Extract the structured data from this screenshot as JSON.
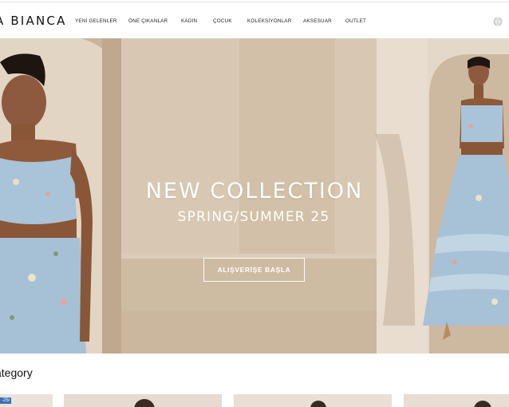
{
  "brand": {
    "logo_text": "A BIANCA"
  },
  "nav": {
    "items": [
      "YENİ GELENLER",
      "ÖNE ÇIKANLAR",
      "KADIN",
      "ÇOCUK",
      "KOLEKSİYONLAR",
      "AKSESUAR",
      "OUTLET"
    ]
  },
  "hero": {
    "title": "NEW COLLECTION",
    "subtitle": "SPRING/SUMMER 25",
    "cta_label": "ALIŞVERİŞE BAŞLA"
  },
  "category_section": {
    "title": "ategory",
    "cards": [
      {
        "badge": "-25/"
      },
      {
        "badge": ""
      },
      {
        "badge": ""
      },
      {
        "badge": ""
      }
    ]
  },
  "colors": {
    "hero_wall": "#d6c4ad",
    "dress_blue": "#a9c3d8",
    "text_dark": "#111111"
  },
  "icons": {
    "language": "globe-icon"
  }
}
